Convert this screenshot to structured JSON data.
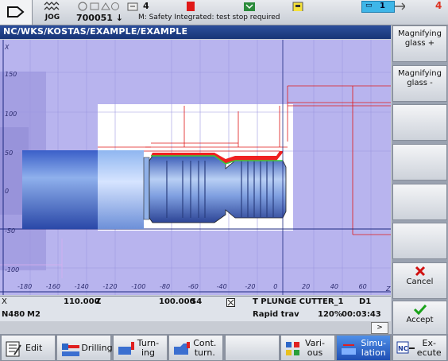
{
  "top": {
    "mode": "JOG",
    "reset_counter": "4",
    "program_number": "700051",
    "program_arrow": "↓",
    "alarm_message": "M: Safety Integrated: test stop required",
    "channel_number": "1",
    "alarm_count": "4"
  },
  "title": "NC/WKS/KOSTAS/EXAMPLE/EXAMPLE",
  "graphic": {
    "y_ticks": [
      "150",
      "100",
      "50",
      "0",
      "-50",
      "-100"
    ],
    "x_ticks": [
      "-180",
      "-160",
      "-140",
      "-120",
      "-100",
      "-80",
      "-60",
      "-40",
      "-20",
      "0",
      "20",
      "40",
      "60"
    ],
    "x_axis_label": "Z",
    "y_axis_label": "X",
    "colors": {
      "background": "#b8b4ee",
      "workpiece": "#4f7ad6",
      "cut": "#f02020",
      "path": "#e01818"
    }
  },
  "right_softkeys": [
    {
      "label": "Magnifying\nglass +",
      "icon": ""
    },
    {
      "label": "Magnifying\nglass -",
      "icon": ""
    },
    {
      "label": "",
      "icon": ""
    },
    {
      "label": "",
      "icon": ""
    },
    {
      "label": "",
      "icon": ""
    },
    {
      "label": "",
      "icon": ""
    },
    {
      "label": "Cancel",
      "icon": "cancel-x-icon"
    },
    {
      "label": "Accept",
      "icon": "accept-check-icon"
    }
  ],
  "data": {
    "row1": {
      "axis_x": "X",
      "value_x": "110.000",
      "axis_z": "Z",
      "value_z": "100.000",
      "spindle": "S4",
      "tool": "T PLUNGE CUTTER_1",
      "cutting_edge": "D1"
    },
    "row2": {
      "block": "N480",
      "mfunc": "M2",
      "feed_mode": "Rapid trav",
      "override": "120%",
      "time": "00:03:43"
    },
    "arrow": ">"
  },
  "bottom_softkeys": [
    {
      "label": "Edit",
      "icon": "edit-icon",
      "active": false
    },
    {
      "label": "Drilling",
      "icon": "drilling-icon",
      "active": false
    },
    {
      "label": "Turn-\ning",
      "icon": "turning-icon",
      "active": false
    },
    {
      "label": "Cont.\nturn.",
      "icon": "contour-turning-icon",
      "active": false
    },
    {
      "label": "",
      "icon": "",
      "active": false
    },
    {
      "label": "Vari-\nous",
      "icon": "various-icon",
      "active": false
    },
    {
      "label": "Simu-\nlation",
      "icon": "simulation-icon",
      "active": true
    },
    {
      "label": "Ex-\necute",
      "icon": "execute-icon",
      "active": false
    }
  ]
}
